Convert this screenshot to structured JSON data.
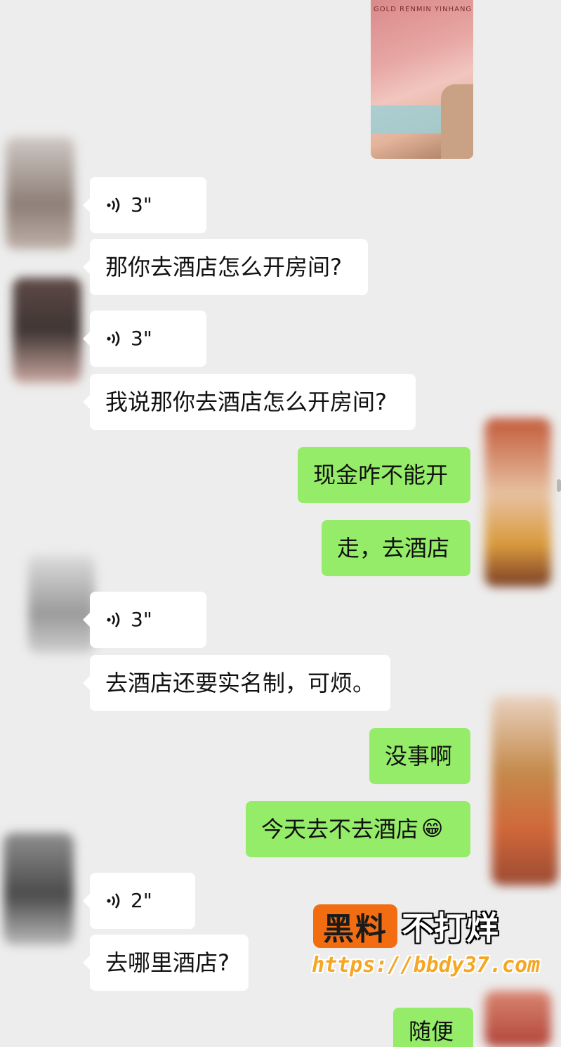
{
  "colors": {
    "background": "#ededed",
    "incoming_bubble": "#ffffff",
    "outgoing_bubble": "#95ec69",
    "watermark_accent": "#f26d12"
  },
  "messages": [
    {
      "type": "voice",
      "side": "left",
      "duration": "3\""
    },
    {
      "type": "text",
      "side": "left",
      "text": "那你去酒店怎么开房间?"
    },
    {
      "type": "voice",
      "side": "left",
      "duration": "3\""
    },
    {
      "type": "text",
      "side": "left",
      "text": "我说那你去酒店怎么开房间?"
    },
    {
      "type": "text",
      "side": "right",
      "text": "现金咋不能开"
    },
    {
      "type": "text",
      "side": "right",
      "text": "走，去酒店"
    },
    {
      "type": "voice",
      "side": "left",
      "duration": "3\""
    },
    {
      "type": "text",
      "side": "left",
      "text": "去酒店还要实名制，可烦。"
    },
    {
      "type": "text",
      "side": "right",
      "text": "没事啊"
    },
    {
      "type": "text",
      "side": "right",
      "text": "今天去不去酒店",
      "emoji": "😁"
    },
    {
      "type": "voice",
      "side": "left",
      "duration": "2\""
    },
    {
      "type": "text",
      "side": "left",
      "text": "去哪里酒店?"
    },
    {
      "type": "text",
      "side": "right",
      "text": "随便"
    }
  ],
  "watermark": {
    "brand": "黑料",
    "slogan": "不打烊",
    "url": "https://bbdy37.com"
  },
  "photo_caption_fragment": "GOLD RENMIN YINHANG"
}
